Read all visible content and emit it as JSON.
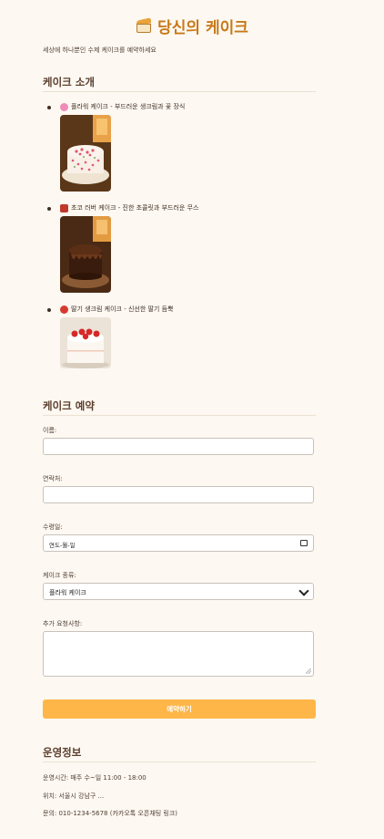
{
  "header": {
    "title": "당신의 케이크",
    "icon": "cake-slice-icon"
  },
  "subtitle": "세상에 하나뿐인 수제 케이크를 예약하세요",
  "intro": {
    "heading": "케이크 소개",
    "items": [
      {
        "icon": "flower-icon",
        "icon_color": "#f08bb8",
        "text": "플라워 케이크 - 부드러운 생크림과 꽃 장식"
      },
      {
        "icon": "chocolate-bar-icon",
        "icon_color": "#c0392b",
        "text": "초코 러버 케이크 - 진한 초콜릿과 부드러운 무스"
      },
      {
        "icon": "strawberry-icon",
        "icon_color": "#d63a2f",
        "text": "딸기 생크림 케이크 - 신선한 딸기 듬뿍"
      }
    ]
  },
  "reserve": {
    "heading": "케이크 예약",
    "name_label": "이름:",
    "phone_label": "연락처:",
    "date_label": "수령일:",
    "date_placeholder": "연도-월-일",
    "type_label": "케이크 종류:",
    "type_selected": "플라워 케이크",
    "request_label": "추가 요청사항:",
    "submit_label": "예약하기"
  },
  "info": {
    "heading": "운영정보",
    "hours": "운영시간: 매주 수~일 11:00 - 18:00",
    "location": "위치: 서울시 강남구 ...",
    "contact": "문의: 010-1234-5678 (카카오톡 오픈채팅 링크)"
  },
  "colors": {
    "accent": "#c87818",
    "button": "#ffb648",
    "background": "#fdf8f1"
  }
}
